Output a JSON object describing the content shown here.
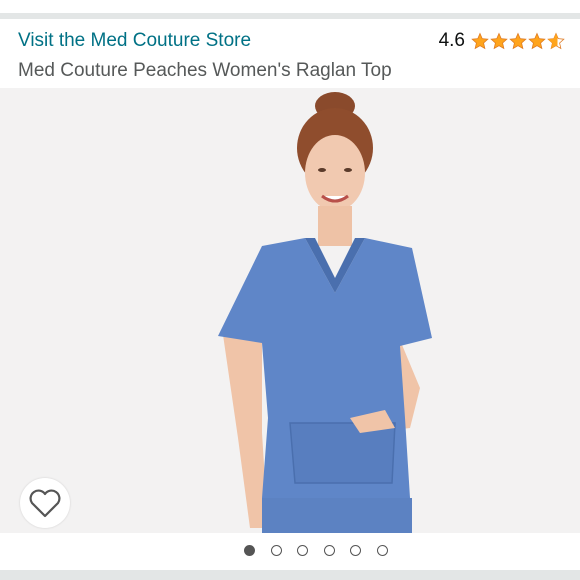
{
  "store_link": "Visit the Med Couture Store",
  "rating": {
    "value": "4.6",
    "stars": 4.6,
    "max_stars": 5,
    "color": "#ffa41c"
  },
  "product_title": "Med Couture Peaches Women's Raglan Top",
  "image": {
    "alt": "",
    "top_color": "#5f86c8",
    "background": "#f3f2f2"
  },
  "wishlist_icon": "heart-outline-icon",
  "carousel": {
    "total": 6,
    "active_index": 0
  },
  "colors": {
    "link": "#007185",
    "text": "#0f1111",
    "subtext": "#565959"
  }
}
